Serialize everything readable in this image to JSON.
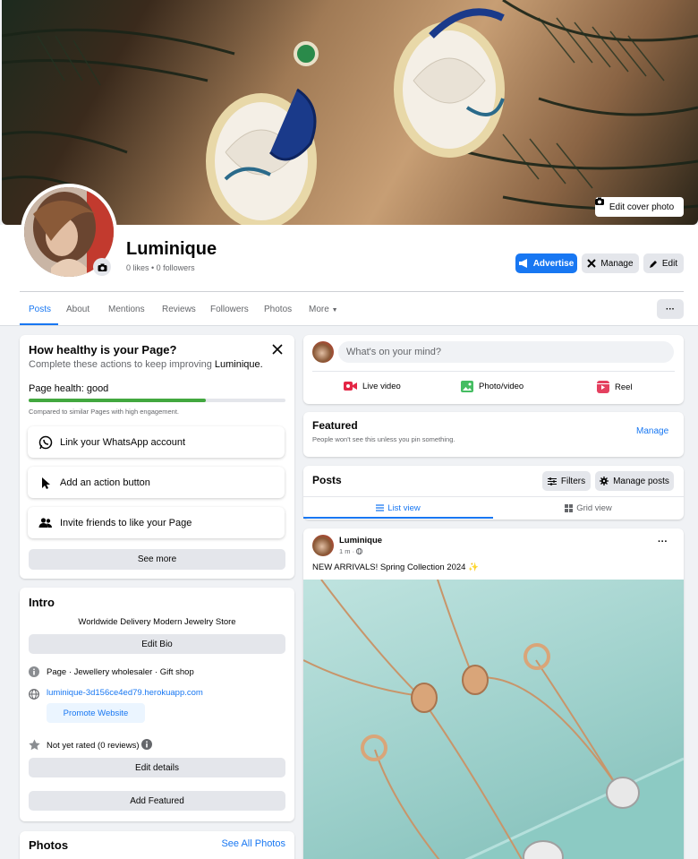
{
  "cover": {
    "edit_label": "Edit cover photo"
  },
  "profile": {
    "name": "Luminique",
    "stats": "0 likes • 0 followers"
  },
  "header_actions": {
    "advertise": "Advertise",
    "manage": "Manage",
    "edit": "Edit"
  },
  "tabs": [
    {
      "label": "Posts",
      "active": true
    },
    {
      "label": "About"
    },
    {
      "label": "Mentions"
    },
    {
      "label": "Reviews"
    },
    {
      "label": "Followers"
    },
    {
      "label": "Photos"
    },
    {
      "label": "More"
    }
  ],
  "more_options": "···",
  "health": {
    "title": "How healthy is your Page?",
    "subtitle_prefix": "Complete these actions to keep improving ",
    "subtitle_name": "Luminique.",
    "status": "Page health: good",
    "progress": 0.69,
    "compare": "Compared to similar Pages with high engagement.",
    "actions": [
      {
        "label": "Link your WhatsApp account",
        "icon": "whatsapp-icon"
      },
      {
        "label": "Add an action button",
        "icon": "cursor-icon"
      },
      {
        "label": "Invite friends to like your Page",
        "icon": "people-icon"
      }
    ],
    "see_more": "See more"
  },
  "intro": {
    "title": "Intro",
    "bio": "Worldwide Delivery Modern Jewelry Store",
    "edit_bio": "Edit Bio",
    "category": "Page · Jewellery wholesaler · Gift shop",
    "website": "luminique-3d156ce4ed79.herokuapp.com",
    "promote": "Promote Website",
    "rating": "Not yet rated (0 reviews)",
    "edit_details": "Edit details",
    "add_featured": "Add Featured"
  },
  "photos": {
    "title": "Photos",
    "see_all": "See All Photos"
  },
  "composer": {
    "placeholder": "What's on your mind?",
    "live": "Live video",
    "photo": "Photo/video",
    "reel": "Reel"
  },
  "featured": {
    "title": "Featured",
    "subtitle": "People won't see this unless you pin something.",
    "manage": "Manage"
  },
  "posts_panel": {
    "title": "Posts",
    "filters": "Filters",
    "manage_posts": "Manage posts",
    "list_view": "List view",
    "grid_view": "Grid view"
  },
  "post": {
    "author": "Luminique",
    "time": "1 m ·",
    "text": "NEW ARRIVALS! Spring Collection 2024 ✨",
    "menu": "···"
  },
  "colors": {
    "accent": "#1877f2",
    "health_bar": "#42a83f",
    "live_red": "#e42645",
    "photo_green": "#45bd62",
    "reel_red": "#e4405f"
  }
}
